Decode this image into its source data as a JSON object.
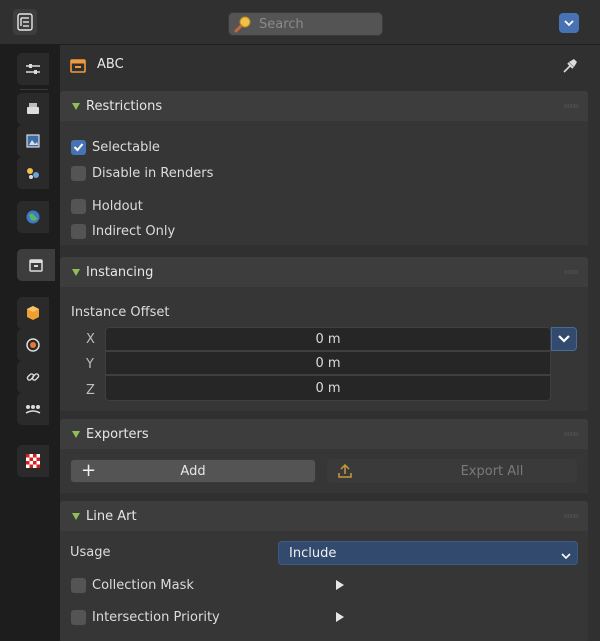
{
  "header": {
    "search_placeholder": "Search"
  },
  "object": {
    "name": "ABC"
  },
  "restrictions": {
    "title": "Restrictions",
    "options": [
      {
        "label": "Selectable",
        "checked": true
      },
      {
        "label": "Disable in Renders",
        "checked": false
      },
      {
        "label": "Holdout",
        "checked": false
      },
      {
        "label": "Indirect Only",
        "checked": false
      }
    ]
  },
  "instancing": {
    "title": "Instancing",
    "offset_label": "Instance Offset",
    "axes": [
      {
        "axis": "X",
        "value": "0 m"
      },
      {
        "axis": "Y",
        "value": "0 m"
      },
      {
        "axis": "Z",
        "value": "0 m"
      }
    ]
  },
  "exporters": {
    "title": "Exporters",
    "add_label": "Add",
    "export_all_label": "Export All"
  },
  "line_art": {
    "title": "Line Art",
    "usage_label": "Usage",
    "usage_value": "Include",
    "collection_mask_label": "Collection Mask",
    "intersection_priority_label": "Intersection Priority"
  },
  "colors": {
    "accent": "#4772b3",
    "panel_triangle": "#8fbf55",
    "usage_select": "#324a6e"
  },
  "icons": [
    "properties-editor-icon",
    "search-icon",
    "dropdown-icon",
    "tool-icon",
    "render-icon",
    "output-icon",
    "view-layer-icon",
    "scene-icon",
    "world-icon",
    "collection-icon",
    "object-icon",
    "modifier-icon",
    "constraint-icon",
    "physics-icon",
    "texture-icon",
    "pin-icon"
  ]
}
